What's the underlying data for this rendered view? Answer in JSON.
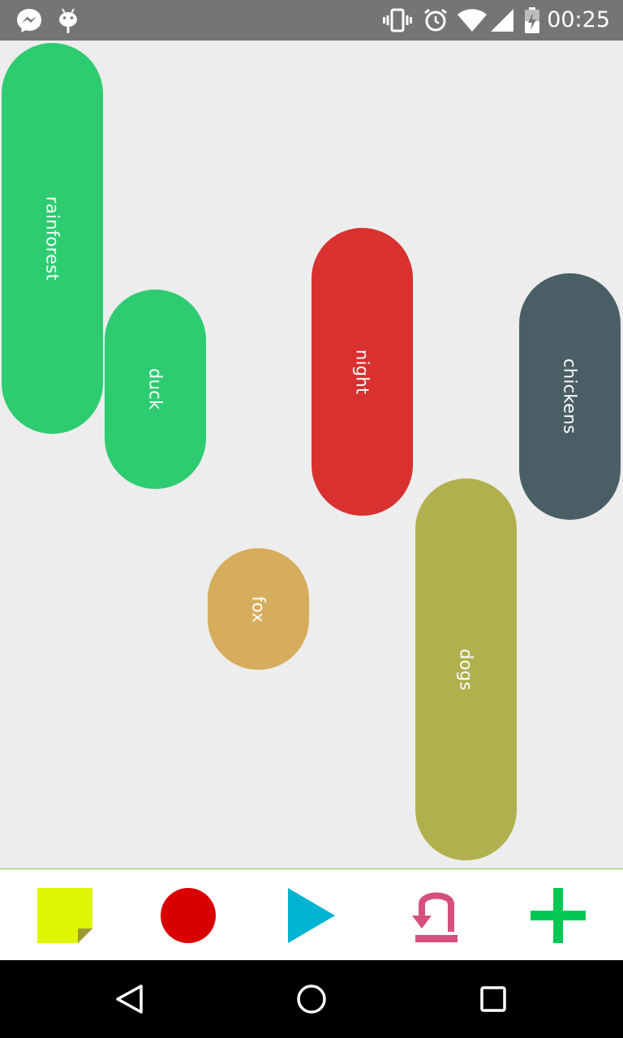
{
  "status_bar": {
    "time": "00:25",
    "icons": [
      "messenger-icon",
      "android-debug-icon",
      "vibrate-icon",
      "alarm-icon",
      "wifi-icon",
      "signal-icon",
      "battery-icon"
    ]
  },
  "pills": [
    {
      "label": "rainforest",
      "color": "#2ecc71"
    },
    {
      "label": "duck",
      "color": "#2ecc71"
    },
    {
      "label": "night",
      "color": "#d93030"
    },
    {
      "label": "chickens",
      "color": "#4a5e66"
    },
    {
      "label": "fox",
      "color": "#d6ad5c"
    },
    {
      "label": "dogs",
      "color": "#b0b04e"
    }
  ],
  "toolbar": {
    "tools": [
      {
        "name": "note-icon",
        "color": "#ddf500"
      },
      {
        "name": "record-icon",
        "color": "#d90000"
      },
      {
        "name": "play-icon",
        "color": "#00b4d2"
      },
      {
        "name": "undo-icon",
        "color": "#d6507c"
      },
      {
        "name": "add-icon",
        "color": "#00c853"
      }
    ]
  },
  "nav_bar": {
    "buttons": [
      "back-icon",
      "home-icon",
      "recents-icon"
    ]
  }
}
